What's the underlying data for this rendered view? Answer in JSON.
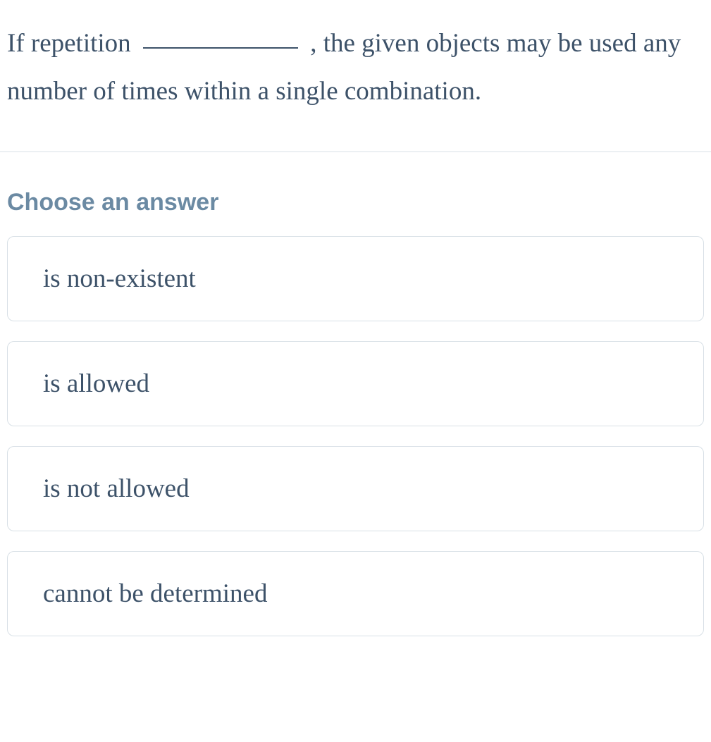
{
  "question": {
    "prefix": "If repetition ",
    "suffix": " , the given objects may be used any number of times within a single combination."
  },
  "prompt": "Choose an answer",
  "options": [
    "is non-existent",
    "is allowed",
    "is not allowed",
    "cannot be determined"
  ]
}
